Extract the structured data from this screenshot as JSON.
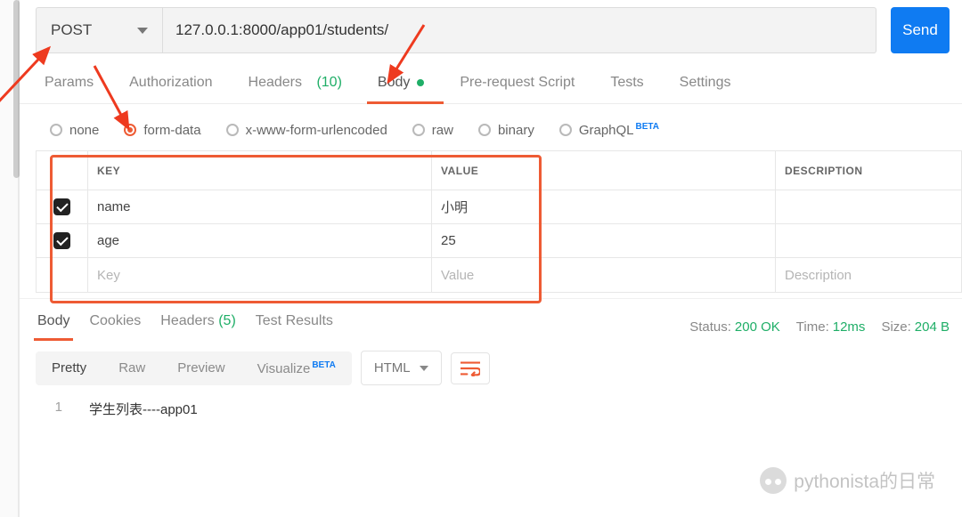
{
  "request": {
    "method": "POST",
    "url": "127.0.0.1:8000/app01/students/",
    "send_label": "Send"
  },
  "req_tabs": {
    "params": "Params",
    "authorization": "Authorization",
    "headers": "Headers",
    "headers_count": "(10)",
    "body": "Body",
    "prerequest": "Pre-request Script",
    "tests": "Tests",
    "settings": "Settings"
  },
  "body_types": {
    "none": "none",
    "form_data": "form-data",
    "x_www": "x-www-form-urlencoded",
    "raw": "raw",
    "binary": "binary",
    "graphql": "GraphQL",
    "beta": "BETA"
  },
  "kv": {
    "key_label": "KEY",
    "value_label": "VALUE",
    "desc_label": "DESCRIPTION",
    "rows": [
      {
        "key": "name",
        "value": "小明"
      },
      {
        "key": "age",
        "value": "25"
      }
    ],
    "key_placeholder": "Key",
    "value_placeholder": "Value",
    "desc_placeholder": "Description"
  },
  "resp_tabs": {
    "body": "Body",
    "cookies": "Cookies",
    "headers": "Headers",
    "headers_count": "(5)",
    "test_results": "Test Results"
  },
  "resp_meta": {
    "status_label": "Status:",
    "status_value": "200 OK",
    "time_label": "Time:",
    "time_value": "12ms",
    "size_label": "Size:",
    "size_value": "204 B"
  },
  "resp_toolbar": {
    "pretty": "Pretty",
    "raw": "Raw",
    "preview": "Preview",
    "visualize": "Visualize",
    "beta": "BETA",
    "fmt": "HTML"
  },
  "response": {
    "line_no": "1",
    "text": "学生列表----app01"
  },
  "watermark": "pythonista的日常"
}
